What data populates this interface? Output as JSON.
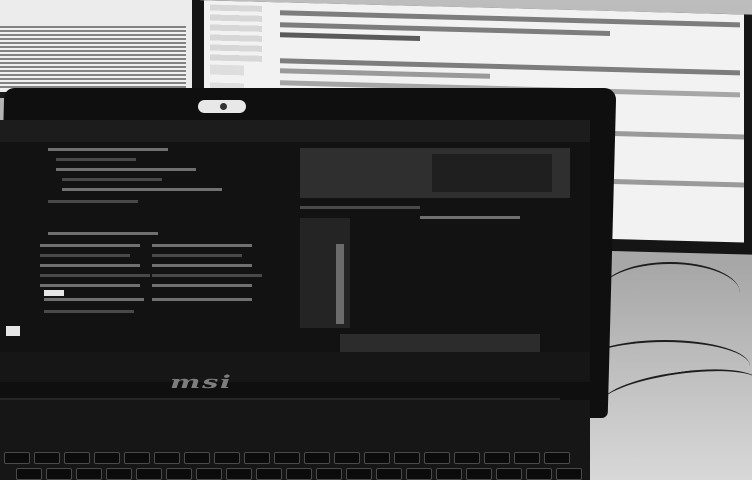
{
  "scene": {
    "description_tag": "photo-laptop-and-monitors",
    "laptop": {
      "brand_logo": "msi"
    },
    "colors": {
      "laptop_body": "#0f0f0f",
      "monitor_screen": "#f2f2f2",
      "desk": "#bdbdbd"
    }
  }
}
